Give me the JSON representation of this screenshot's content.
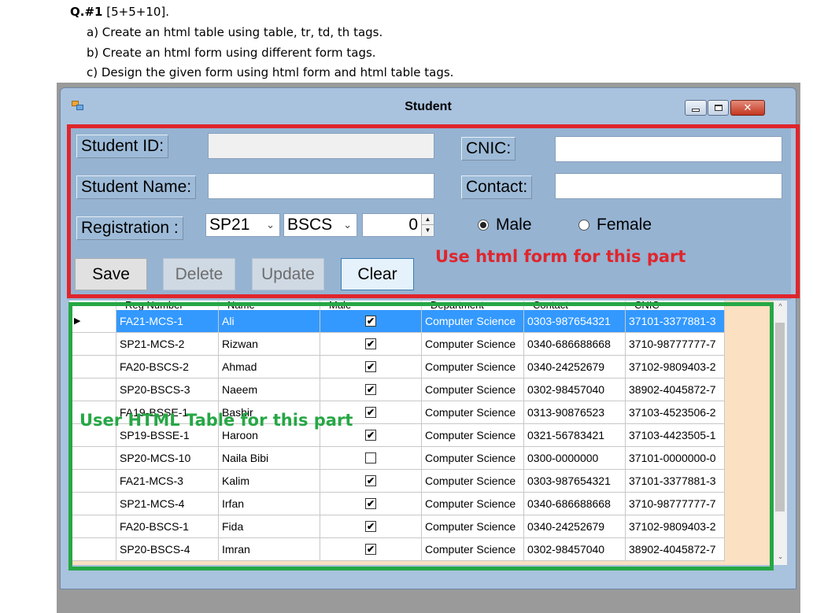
{
  "doc": {
    "question_label": "Q.#1",
    "marks": "[5+5+10].",
    "items": [
      "a) Create an html table using table, tr, td, th tags.",
      "b) Create an html form using different form tags.",
      "c) Design the given form using html form and html table tags."
    ]
  },
  "window": {
    "title": "Student",
    "icon": "app-form-icon",
    "controls": [
      "minimize-icon",
      "maximize-icon",
      "close-icon"
    ],
    "close_glyph": "✕"
  },
  "form": {
    "student_id_label": "Student ID:",
    "student_id_value": "",
    "student_name_label": "Student Name:",
    "student_name_value": "",
    "cnic_label": "CNIC:",
    "cnic_value": "",
    "contact_label": "Contact:",
    "contact_value": "",
    "registration_label": "Registration :",
    "session_value": "SP21",
    "program_value": "BSCS",
    "number_value": "0",
    "gender_options": [
      {
        "label": "Male",
        "selected": true
      },
      {
        "label": "Female",
        "selected": false
      }
    ],
    "buttons": {
      "save": "Save",
      "delete": "Delete",
      "update": "Update",
      "clear": "Clear"
    }
  },
  "annotations": {
    "form_note": "Use html form for this part",
    "table_note": "User HTML Table for this part",
    "form_note_color": "#e0252c",
    "table_note_color": "#26a745"
  },
  "grid": {
    "columns": [
      "Reg Number",
      "Name",
      "Male",
      "Department",
      "Contact",
      "CNIC"
    ],
    "rows": [
      {
        "reg": "FA21-MCS-1",
        "name": "Ali",
        "male": true,
        "dept": "Computer Science",
        "contact": "0303-987654321",
        "cnic": "37101-3377881-3",
        "selected": true
      },
      {
        "reg": "SP21-MCS-2",
        "name": "Rizwan",
        "male": true,
        "dept": "Computer Science",
        "contact": "0340-686688668",
        "cnic": "3710-98777777-7",
        "selected": false
      },
      {
        "reg": "FA20-BSCS-2",
        "name": "Ahmad",
        "male": true,
        "dept": "Computer Science",
        "contact": "0340-24252679",
        "cnic": "37102-9809403-2",
        "selected": false
      },
      {
        "reg": "SP20-BSCS-3",
        "name": "Naeem",
        "male": true,
        "dept": "Computer Science",
        "contact": "0302-98457040",
        "cnic": "38902-4045872-7",
        "selected": false
      },
      {
        "reg": "FA19-BSSE-1",
        "name": "Bashir",
        "male": true,
        "dept": "Computer Science",
        "contact": "0313-90876523",
        "cnic": "37103-4523506-2",
        "selected": false
      },
      {
        "reg": "SP19-BSSE-1",
        "name": "Haroon",
        "male": true,
        "dept": "Computer Science",
        "contact": "0321-56783421",
        "cnic": "37103-4423505-1",
        "selected": false
      },
      {
        "reg": "SP20-MCS-10",
        "name": "Naila Bibi",
        "male": false,
        "dept": "Computer Science",
        "contact": "0300-0000000",
        "cnic": "37101-0000000-0",
        "selected": false
      },
      {
        "reg": "FA21-MCS-3",
        "name": "Kalim",
        "male": true,
        "dept": "Computer Science",
        "contact": "0303-987654321",
        "cnic": "37101-3377881-3",
        "selected": false
      },
      {
        "reg": "SP21-MCS-4",
        "name": "Irfan",
        "male": true,
        "dept": "Computer Science",
        "contact": "0340-686688668",
        "cnic": "3710-98777777-7",
        "selected": false
      },
      {
        "reg": "FA20-BSCS-1",
        "name": "Fida",
        "male": true,
        "dept": "Computer Science",
        "contact": "0340-24252679",
        "cnic": "37102-9809403-2",
        "selected": false
      },
      {
        "reg": "SP20-BSCS-4",
        "name": "Imran",
        "male": true,
        "dept": "Computer Science",
        "contact": "0302-98457040",
        "cnic": "38902-4045872-7",
        "selected": false
      }
    ],
    "row_indicator": "▶",
    "check_glyph": "✔",
    "selection_color": "#3399ff"
  }
}
